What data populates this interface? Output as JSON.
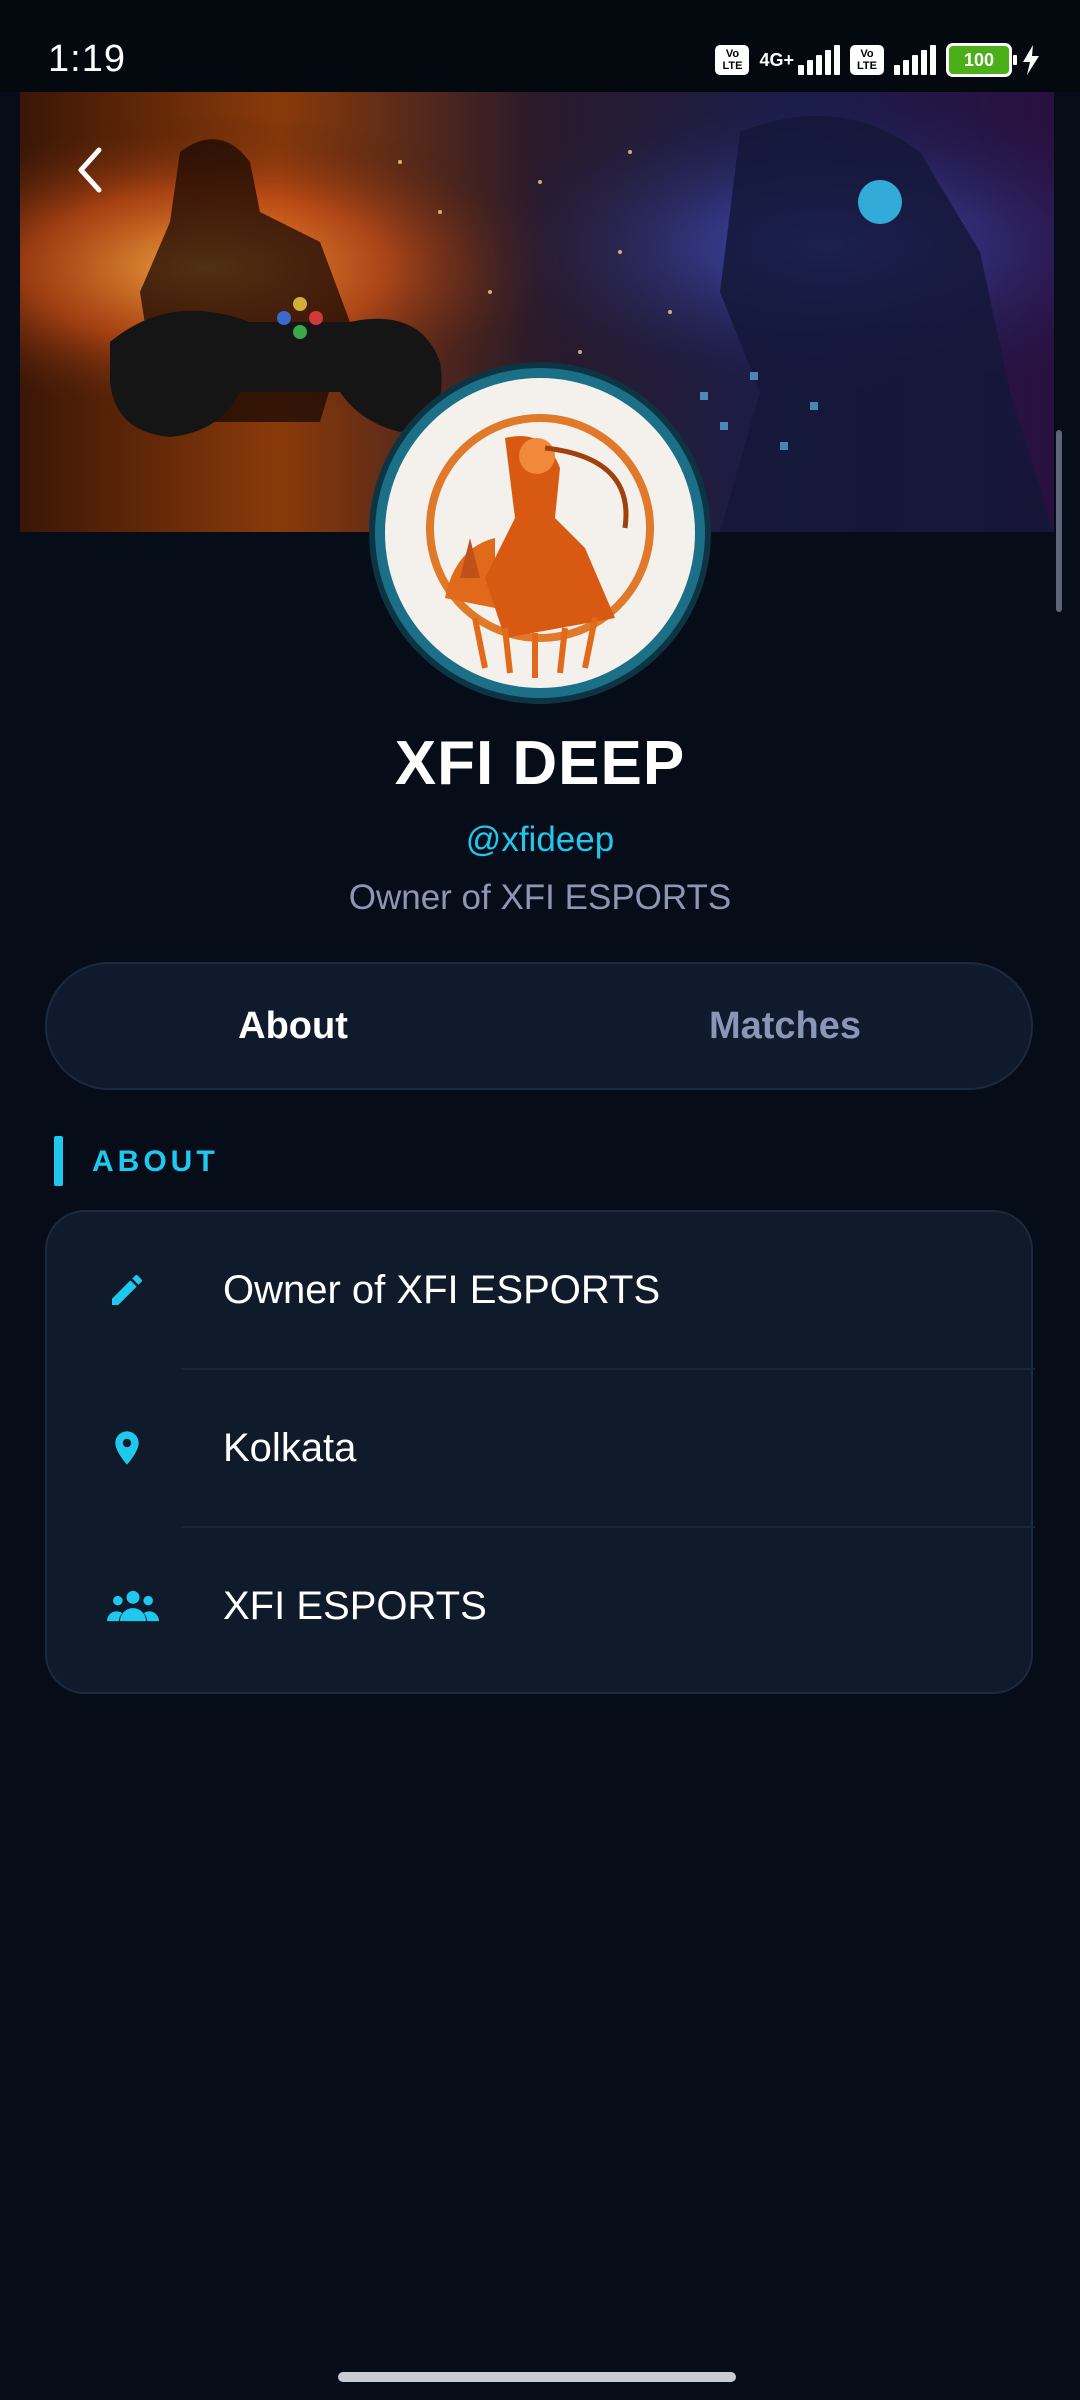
{
  "status_bar": {
    "time": "1:19",
    "volte_label_top": "Vo",
    "volte_label_bottom": "LTE",
    "network": "4G+",
    "battery": "100"
  },
  "profile": {
    "name": "XFI DEEP",
    "handle": "@xfideep",
    "bio": "Owner of XFI ESPORTS"
  },
  "tabs": [
    {
      "label": "About",
      "active": true
    },
    {
      "label": "Matches",
      "active": false
    }
  ],
  "about_section": {
    "title": "ABOUT",
    "items": [
      {
        "icon": "pencil-icon",
        "text": "Owner of XFI ESPORTS"
      },
      {
        "icon": "location-pin-icon",
        "text": "Kolkata"
      },
      {
        "icon": "group-icon",
        "text": "XFI ESPORTS"
      }
    ]
  },
  "colors": {
    "background": "#070c19",
    "accent": "#1fc9ee",
    "card": "#0f1a2a",
    "muted_text": "#8d97b4"
  }
}
